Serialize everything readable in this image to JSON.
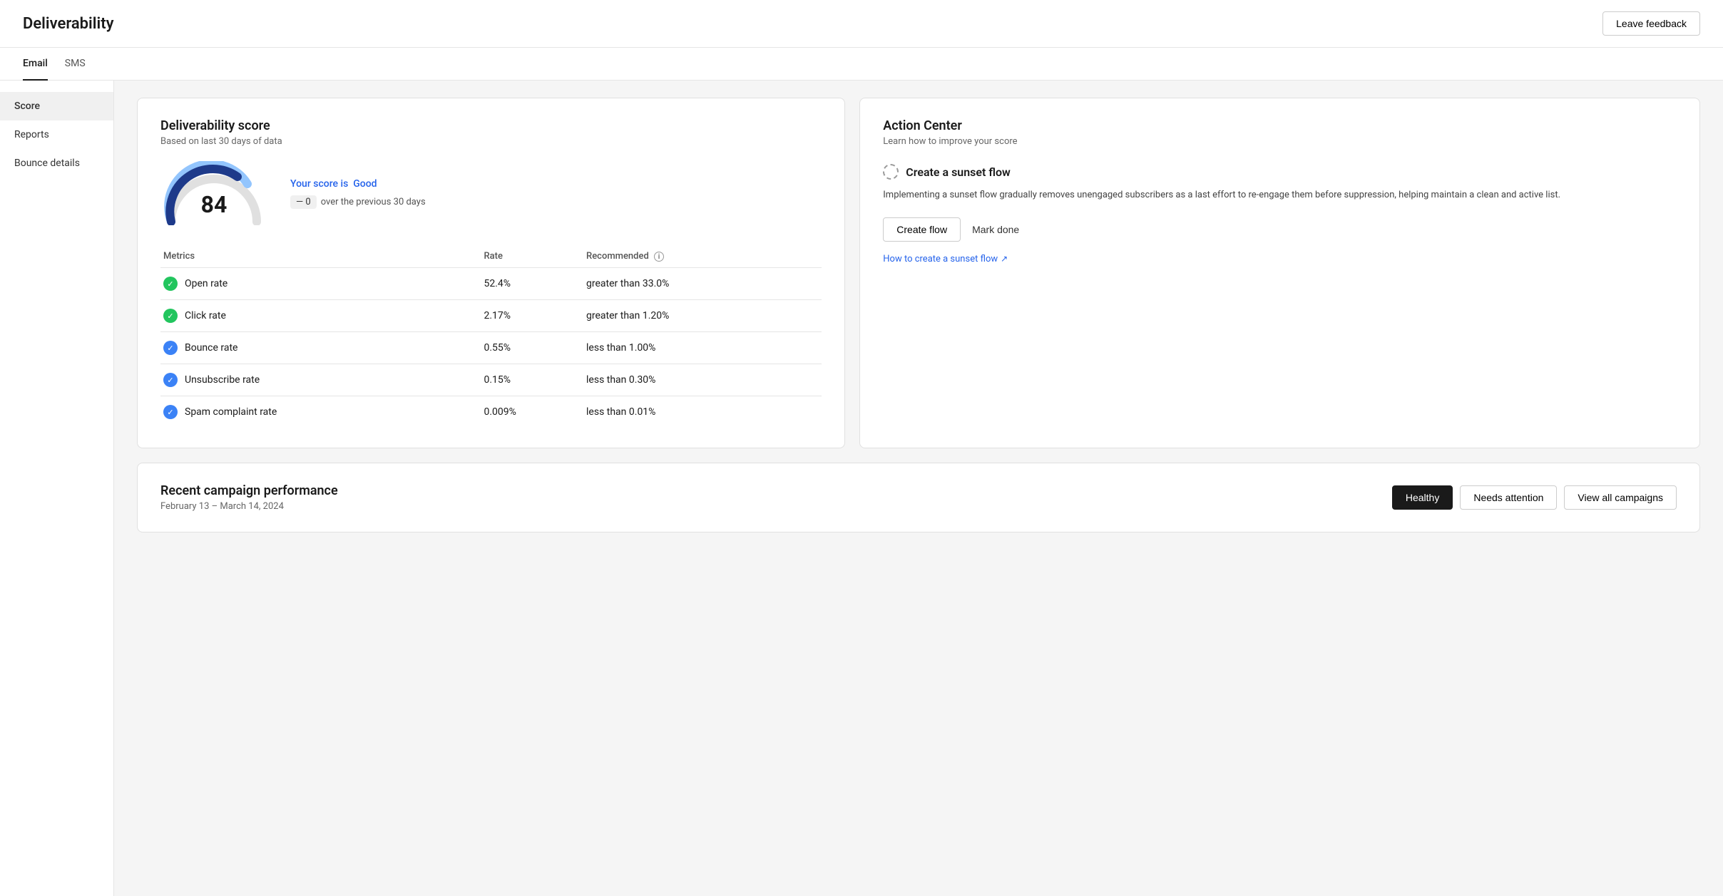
{
  "header": {
    "title": "Deliverability",
    "leave_feedback_label": "Leave feedback"
  },
  "tabs": [
    {
      "id": "email",
      "label": "Email",
      "active": true
    },
    {
      "id": "sms",
      "label": "SMS",
      "active": false
    }
  ],
  "sidebar": {
    "items": [
      {
        "id": "score",
        "label": "Score",
        "active": true
      },
      {
        "id": "reports",
        "label": "Reports",
        "active": false
      },
      {
        "id": "bounce-details",
        "label": "Bounce details",
        "active": false
      }
    ]
  },
  "score_card": {
    "title": "Deliverability score",
    "subtitle": "Based on last 30 days of data",
    "score_value": "84",
    "score_is_label": "Your score is",
    "score_quality": "Good",
    "score_change_value": "0",
    "score_change_period": "over the previous 30 days",
    "metrics_headers": {
      "metric": "Metrics",
      "rate": "Rate",
      "recommended": "Recommended"
    },
    "metrics": [
      {
        "name": "Open rate",
        "rate": "52.4%",
        "recommended": "greater than 33.0%",
        "status": "green"
      },
      {
        "name": "Click rate",
        "rate": "2.17%",
        "recommended": "greater than 1.20%",
        "status": "green"
      },
      {
        "name": "Bounce rate",
        "rate": "0.55%",
        "recommended": "less than 1.00%",
        "status": "blue"
      },
      {
        "name": "Unsubscribe rate",
        "rate": "0.15%",
        "recommended": "less than 0.30%",
        "status": "blue"
      },
      {
        "name": "Spam complaint rate",
        "rate": "0.009%",
        "recommended": "less than 0.01%",
        "status": "blue"
      }
    ]
  },
  "action_center": {
    "title": "Action Center",
    "subtitle": "Learn how to improve your score",
    "item": {
      "title": "Create a sunset flow",
      "description": "Implementing a sunset flow gradually removes unengaged subscribers as a last effort to re-engage them before suppression, helping maintain a clean and active list.",
      "create_flow_label": "Create flow",
      "mark_done_label": "Mark done",
      "link_label": "How to create a sunset flow",
      "link_icon": "↗"
    }
  },
  "recent_campaigns": {
    "title": "Recent campaign performance",
    "subtitle": "February 13 – March 14, 2024",
    "healthy_label": "Healthy",
    "needs_attention_label": "Needs attention",
    "view_all_label": "View all campaigns"
  },
  "gauge": {
    "bg_color": "#e8e8e8",
    "fill_color": "#1e4fa3",
    "light_fill": "#93c5fd",
    "percent": 84
  }
}
